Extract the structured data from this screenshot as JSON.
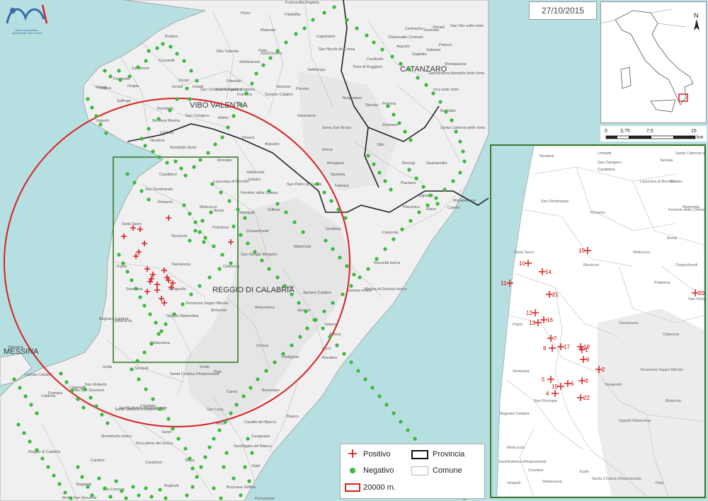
{
  "date": "27/10/2015",
  "logo": {
    "line1": "Istituto Zooprofilattico",
    "line2": "Sperimentale delle Venezie"
  },
  "provinces": [
    "VIBO VALENTIA",
    "CATANZARO",
    "REGGIO DI CALABRIA",
    "MESSINA"
  ],
  "places": [
    "Tropea",
    "Parghelia",
    "Zambrone",
    "Briatico",
    "Cessaniti",
    "Vibo Valentia",
    "Pizzo",
    "Maierato",
    "Filadelfia",
    "Francavilla Angitola",
    "Polia",
    "Capistrano",
    "San Nicola da Crissa",
    "Vallelonga",
    "Torre di Ruggiero",
    "Cardinale",
    "Soverato",
    "Stefanaconi",
    "Sant'Onofrio",
    "Francica",
    "Mileto",
    "Soriano Calabro",
    "Pizzoni",
    "Vazzano",
    "Gerocarne",
    "Dinami",
    "Acquaro",
    "Arena",
    "Serra San Bruno",
    "Mongiana",
    "Fabrizia",
    "Stilo",
    "Bivongi",
    "Pazzano",
    "Guardavalle",
    "Rombiolo",
    "Limbadi",
    "Nicotera",
    "Joppolo",
    "Ricadi",
    "Drapia",
    "Spilinga",
    "Candidoni",
    "San Ferdinando",
    "Rosarno",
    "Laureana di Borrello",
    "Feroleto della Chiesa",
    "Melicucco",
    "Anoia",
    "Maropati",
    "Giffone",
    "San Pietro di Caridà",
    "Galatro",
    "Gioia Tauro",
    "Rizziconi",
    "Polistena",
    "Cinquefrondi",
    "Grotteria",
    "Mammola",
    "San Giorgio Morgeto",
    "Cittanova",
    "Taurianova",
    "Palmi",
    "Seminara",
    "Varapodio",
    "Terranova Sappo Minulio",
    "Molochio",
    "Oppido Mamertina",
    "Melicuccà",
    "Bagnara Calabra",
    "Delianuova",
    "Scido",
    "Santa Cristina d'Aspromonte",
    "Sinopoli",
    "Cosoleto",
    "Sant'Eufemia d'Aspromonte",
    "Scilla",
    "Platì",
    "Cimina",
    "Antonimina",
    "Gerace",
    "Locri",
    "Canolo",
    "Agnana Calabra",
    "Siderno",
    "Portigliola",
    "Caulonia",
    "Roccella Ionica",
    "Marina di Gioiosa Ionica",
    "Gioiosa Ionica",
    "Ardore",
    "Bovalino",
    "Careri",
    "Benestare",
    "San Luca",
    "Samo",
    "Africo",
    "Bianco",
    "Casignana",
    "Sant'Agata del Bianco",
    "Caraffa del Bianco",
    "Staiti",
    "Bruzzano Zeffirio",
    "Ferruzzano",
    "Bova",
    "Condofuri",
    "Roccaforte del Greco",
    "Roghudi",
    "Cardeto",
    "Bagaladi",
    "San Lorenzo",
    "Motta San Giovanni",
    "Montebello Ionico",
    "Villa San Giovanni",
    "Campo Calabro",
    "Fiumara",
    "San Roberto",
    "Calanna",
    "Laganadi",
    "Santo Stefano in Aspromonte",
    "Reggio di Calabria",
    "Messina",
    "Monasterace",
    "Camini",
    "Riace",
    "Stignano",
    "Placanica",
    "Badolato",
    "Santa Caterina dello Ionio",
    "Isca sullo Ionio",
    "Sant'Andrea Apostolo dello Ionio",
    "Chiaravalle Centrale",
    "Argusto",
    "Gagliato",
    "Satriano",
    "Petrizzi",
    "Centrache",
    "Olivadi",
    "San Vito sullo Ionio",
    "Montepaone",
    "Petronà",
    "Zungri",
    "San Calogero",
    "Nicotera Marina",
    "Filandari",
    "San Costantino Calabro",
    "San Gregorio d'Ippona",
    "Ionadi",
    "Jonadi",
    "Rombiolo Nord",
    "Montalto",
    "Serrata",
    "Brognaturo",
    "Spadola",
    "Simbario",
    "Vallefiorita",
    "Caria"
  ],
  "inset_labels": [
    "Nicotera",
    "Limbadi",
    "San Calogero",
    "Candidoni",
    "Serrata",
    "Laureana di Borrello",
    "San Ferdinando",
    "Rosarno",
    "Feroleto della Chiesa",
    "Gioia Tauro",
    "Rizziconi",
    "Melicucco",
    "Polistena",
    "Cinquefrondi",
    "Palmi",
    "Taurianova",
    "Cittanova",
    "Seminara",
    "Terranova Sappo Minulio",
    "Varapodio",
    "Molochio",
    "San Procopio",
    "Oppido Mamertina",
    "Bagnara Calabra",
    "Melicuccà",
    "Sant'Eufemia d'Aspromonte",
    "Cosoleto",
    "Scido",
    "Santa Cristina d'Aspromonte",
    "Delianuova",
    "Sinopoli",
    "Platì",
    "Anoia",
    "Mammola",
    "San Giorgio Morgeto",
    "Galatro",
    "Santa Caterina dello Ionio"
  ],
  "inset_numbers": [
    "1",
    "2",
    "3",
    "4",
    "5",
    "6",
    "7",
    "8",
    "9",
    "10",
    "11",
    "12",
    "13",
    "14",
    "15",
    "16",
    "17",
    "18",
    "19",
    "20",
    "21",
    "22"
  ],
  "scale": {
    "labels": [
      "0",
      "3,75",
      "7,5",
      "15"
    ],
    "unit": "km"
  },
  "north": "N",
  "legend": {
    "positive": "Positivo",
    "negative": "Negativo",
    "province": "Provincia",
    "municipality": "Comune",
    "buffer": "20000 m."
  },
  "colors": {
    "sea": "#b6dfe1",
    "land": "#f0f0f0",
    "positive": "#d32020",
    "negative": "#3cb83c",
    "buffer": "#d62020",
    "inset_frame": "#3a7a2a"
  }
}
